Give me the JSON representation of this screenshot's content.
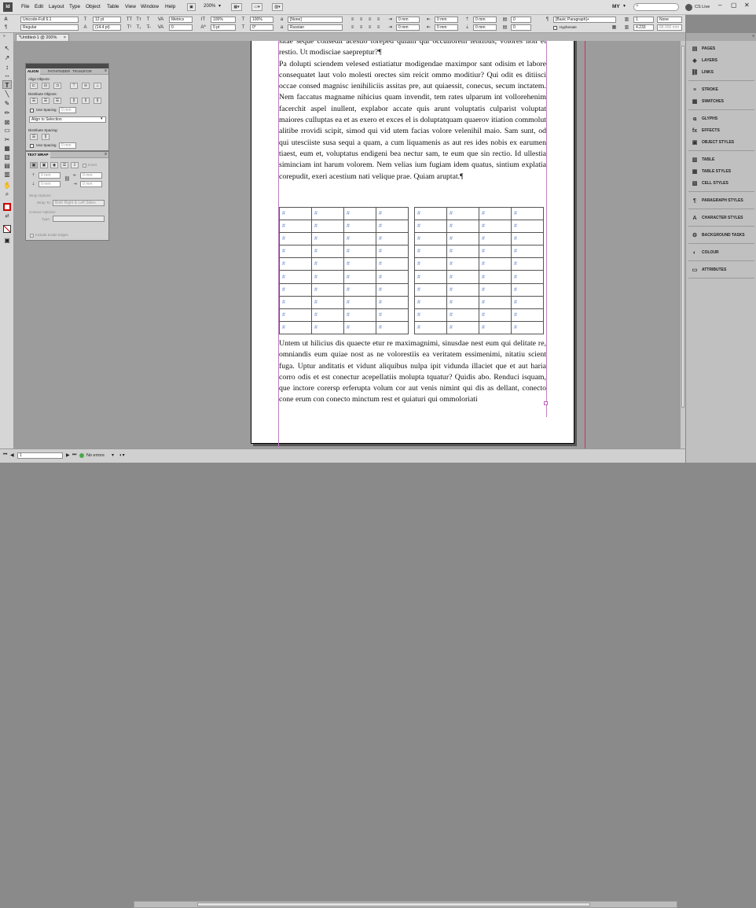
{
  "app": {
    "menu": [
      "File",
      "Edit",
      "Layout",
      "Type",
      "Object",
      "Table",
      "View",
      "Window",
      "Help"
    ],
    "zoom_display": "200%",
    "workspace": "MY",
    "cs_live": "CS Live"
  },
  "control_panel": {
    "font_family": "Unicode-Full 6.1",
    "font_style": "Regular",
    "font_size": "12 pt",
    "leading": "(14.4 pt)",
    "kerning": "Metrics",
    "tracking": "0",
    "horizontal_scale": "100%",
    "vertical_scale": "100%",
    "baseline_shift": "0 pt",
    "skew": "0°",
    "character_style": "[None]",
    "language": "Russian",
    "left_indent": "0 mm",
    "right_indent": "0 mm",
    "first_line_indent": "0 mm",
    "last_line_indent": "0 mm",
    "space_before": "0 mm",
    "space_after": "0 mm",
    "paragraph_style": "[Basic Paragraph]+",
    "hyphenate_label": "Hyphenate",
    "drop_cap_lines": "0",
    "drop_cap_chars": "0",
    "columns": "1",
    "gutter": "4.233",
    "column_width": "88.000 mm",
    "shading": "None",
    "shading_offset": "0"
  },
  "document_tab": {
    "title": "*Untitled-1 @ 200%",
    "close_glyph": "×"
  },
  "tools": {
    "glyphs": [
      "↖",
      "↗",
      "↕",
      "↔",
      "T",
      "╲",
      "✎",
      "✏",
      "⊠",
      "▭",
      "✂",
      "▦",
      "▧",
      "▤",
      "▥",
      "✋",
      "⌕",
      "◪",
      "⇄",
      "▣",
      "◫"
    ]
  },
  "document": {
    "text_top": "sitae seque consedit acestio toreped quiam qui occullorem lentibus, volores non et restio. Ut modisciae saepreptur?¶\nPa dolupti sciendem velesed estiatiatur modigendae maximpor sant odisim et labore consequatet laut volo molesti orectes sim reicit ommo moditiur? Qui odit es ditiisci occae consed magnisc ienihiliciis assitas pre, aut quiaessit, conecus, secum inctatem. Nem faccatus magname nihicius quam invendit, tem rates ulparum int vollorehenim facerchit aspel inullent, explabor accate quis arunt voluptatis culparist voluptat maiores culluptas ea et as exero et exces el is doluptatquam quaerov itiation commolut alitibe rrovidi scipit, simod qui vid utem facias volore velenihil maio. Sam sunt, od qui utesciiste susa sequi a quam, a cum liquamenis as aut res ides nobis ex earumen tiaest, eum et, voluptatus endigeni bea nectur sam, te eum que sin rectio. Id ullestia siminciam int harum volorem. Nem velias ium fugiam idem quatus, sintium explatia corepudit, exeri acestium nati velique prae. Quiam aruptat.¶",
    "text_bottom": "Untem ut hilicius dis quaecte etur re maximagnimi, sinusdae nest eum qui delitate re, omniandis eum quiae nost as ne volorestiis ea veritatem essimenimi, nitatiu scient fuga. Uptur anditatis et vidunt aliquibus nulpa ipit vidunda illaciet que et aut haria corro odis et est conectur acepellatiis molupta tquatur? Quidis abo. Renduci isquam, que inctore corersp erferupta volum cor aut venis nimint qui dis as dellant, conecto cone erum con conecto minctum rest et quiaturi qui ommoloriati",
    "cell_placeholder": "#",
    "table_rows": 10,
    "table_cols": 4
  },
  "align_panel": {
    "tabs": [
      "ALIGN",
      "PATHFINDER",
      "TRANSFOR"
    ],
    "align_objects_label": "Align Objects:",
    "distribute_objects_label": "Distribute Objects:",
    "use_spacing_label": "Use Spacing",
    "spacing_value": "0 mm",
    "align_to": "Align to Selection",
    "distribute_spacing_label": "Distribute Spacing:",
    "use_spacing_label_2": "Use Spacing",
    "spacing_value_2": "0 mm"
  },
  "textwrap_panel": {
    "title": "TEXT WRAP",
    "invert_label": "Invert",
    "offset_top": "0 mm",
    "offset_bottom": "0 mm",
    "offset_left": "0 mm",
    "offset_right": "0 mm",
    "wrap_options_label": "Wrap Options:",
    "wrap_to_label": "Wrap To:",
    "wrap_to_value": "Both Right & Left Sides",
    "contour_options_label": "Contour Options:",
    "type_label": "Type:",
    "include_inside_edges": "Include Inside Edges"
  },
  "right_panels": [
    {
      "name": "PAGES",
      "icon": "▤"
    },
    {
      "name": "LAYERS",
      "icon": "◈"
    },
    {
      "name": "LINKS",
      "icon": "⛓"
    },
    {
      "name": "STROKE",
      "icon": "≡"
    },
    {
      "name": "SWATCHES",
      "icon": "▦"
    },
    {
      "name": "GLYPHS",
      "icon": "ꬰ"
    },
    {
      "name": "EFFECTS",
      "icon": "fx"
    },
    {
      "name": "OBJECT STYLES",
      "icon": "▣"
    },
    {
      "name": "TABLE",
      "icon": "▥"
    },
    {
      "name": "TABLE STYLES",
      "icon": "▦"
    },
    {
      "name": "CELL STYLES",
      "icon": "▧"
    },
    {
      "name": "PARAGRAPH STYLES",
      "icon": "¶"
    },
    {
      "name": "CHARACTER STYLES",
      "icon": "A"
    },
    {
      "name": "BACKGROUND TASKS",
      "icon": "⚙"
    },
    {
      "name": "COLOUR",
      "icon": "◐"
    },
    {
      "name": "ATTRIBUTES",
      "icon": "▭"
    }
  ],
  "status": {
    "page": "1",
    "preflight": "No errors"
  }
}
